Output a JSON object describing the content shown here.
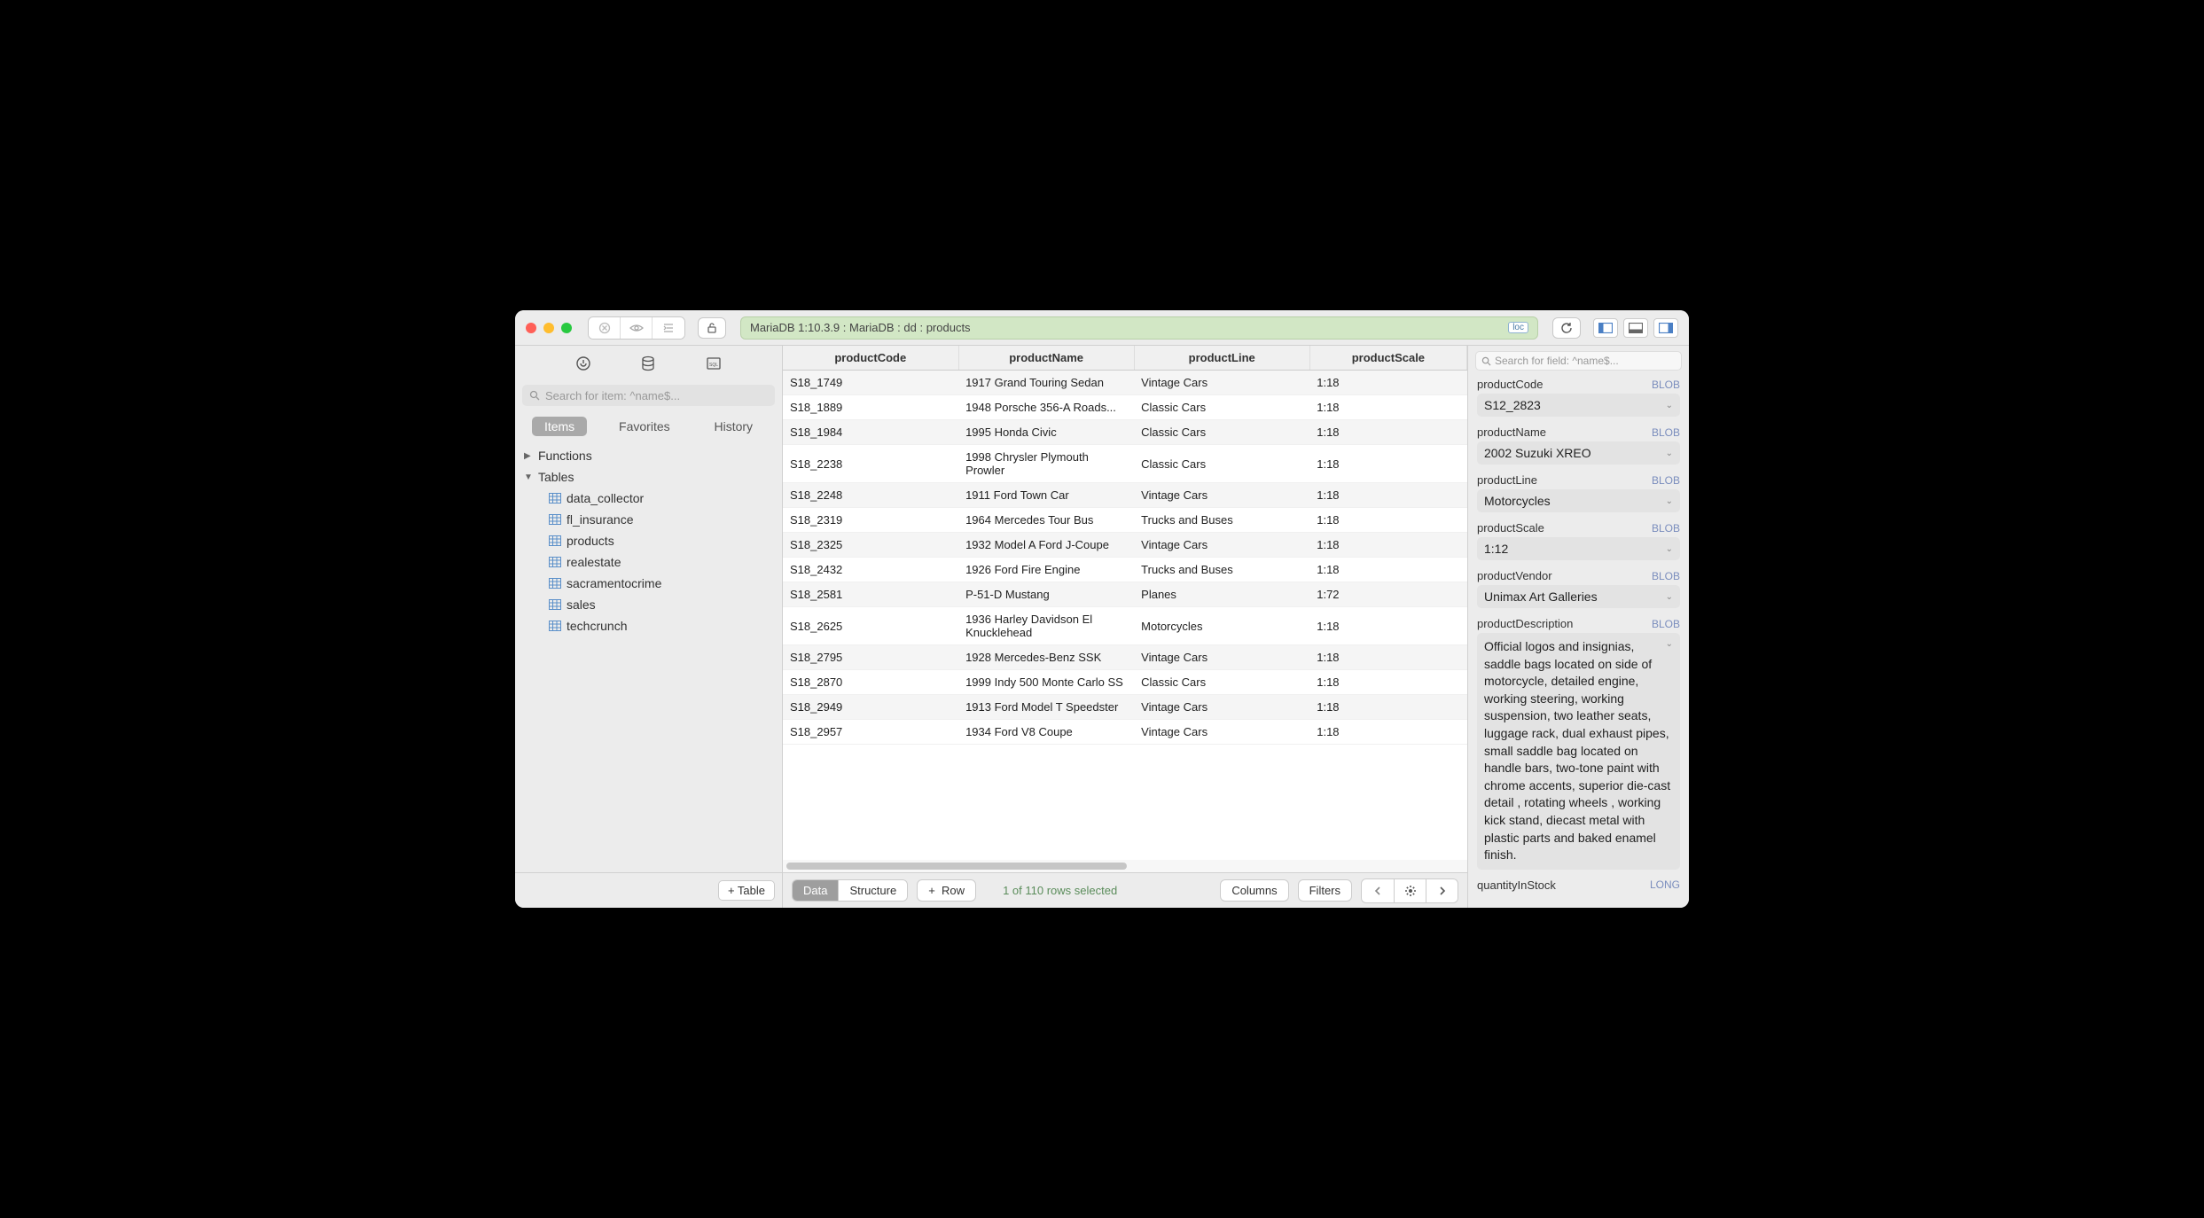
{
  "titlebar": {
    "path": "MariaDB 1:10.3.9 : MariaDB : dd : products",
    "loc_badge": "loc"
  },
  "sidebar": {
    "search_placeholder": "Search for item: ^name$...",
    "tabs": {
      "items": "Items",
      "favorites": "Favorites",
      "history": "History"
    },
    "tree": {
      "functions": "Functions",
      "tables": "Tables",
      "table_items": [
        "data_collector",
        "fl_insurance",
        "products",
        "realestate",
        "sacramentocrime",
        "sales",
        "techcrunch"
      ]
    },
    "add_table": "Table"
  },
  "table": {
    "headers": [
      "productCode",
      "productName",
      "productLine",
      "productScale"
    ],
    "rows": [
      {
        "code": "S18_1749",
        "name": "1917 Grand Touring Sedan",
        "line": "Vintage Cars",
        "scale": "1:18"
      },
      {
        "code": "S18_1889",
        "name": "1948 Porsche 356-A Roads...",
        "line": "Classic Cars",
        "scale": "1:18"
      },
      {
        "code": "S18_1984",
        "name": "1995 Honda Civic",
        "line": "Classic Cars",
        "scale": "1:18"
      },
      {
        "code": "S18_2238",
        "name": "1998 Chrysler Plymouth Prowler",
        "line": "Classic Cars",
        "scale": "1:18"
      },
      {
        "code": "S18_2248",
        "name": "1911 Ford Town Car",
        "line": "Vintage Cars",
        "scale": "1:18"
      },
      {
        "code": "S18_2319",
        "name": "1964 Mercedes Tour Bus",
        "line": "Trucks and Buses",
        "scale": "1:18"
      },
      {
        "code": "S18_2325",
        "name": "1932 Model A Ford J-Coupe",
        "line": "Vintage Cars",
        "scale": "1:18"
      },
      {
        "code": "S18_2432",
        "name": "1926 Ford Fire Engine",
        "line": "Trucks and Buses",
        "scale": "1:18"
      },
      {
        "code": "S18_2581",
        "name": "P-51-D Mustang",
        "line": "Planes",
        "scale": "1:72"
      },
      {
        "code": "S18_2625",
        "name": "1936 Harley Davidson El Knucklehead",
        "line": "Motorcycles",
        "scale": "1:18"
      },
      {
        "code": "S18_2795",
        "name": "1928 Mercedes-Benz SSK",
        "line": "Vintage Cars",
        "scale": "1:18"
      },
      {
        "code": "S18_2870",
        "name": "1999 Indy 500 Monte Carlo SS",
        "line": "Classic Cars",
        "scale": "1:18"
      },
      {
        "code": "S18_2949",
        "name": "1913 Ford Model T Speedster",
        "line": "Vintage Cars",
        "scale": "1:18"
      },
      {
        "code": "S18_2957",
        "name": "1934 Ford V8 Coupe",
        "line": "Vintage Cars",
        "scale": "1:18"
      }
    ]
  },
  "footer": {
    "data": "Data",
    "structure": "Structure",
    "row": "Row",
    "status": "1 of 110 rows selected",
    "columns": "Columns",
    "filters": "Filters"
  },
  "inspector": {
    "search_placeholder": "Search for field: ^name$...",
    "fields": [
      {
        "label": "productCode",
        "type": "BLOB",
        "value": "S12_2823"
      },
      {
        "label": "productName",
        "type": "BLOB",
        "value": "2002 Suzuki XREO"
      },
      {
        "label": "productLine",
        "type": "BLOB",
        "value": "Motorcycles"
      },
      {
        "label": "productScale",
        "type": "BLOB",
        "value": "1:12"
      },
      {
        "label": "productVendor",
        "type": "BLOB",
        "value": "Unimax Art Galleries"
      }
    ],
    "description": {
      "label": "productDescription",
      "type": "BLOB",
      "value": "Official logos and insignias, saddle bags located on side of motorcycle, detailed engine, working steering, working suspension, two leather seats, luggage rack, dual exhaust pipes, small saddle bag located on handle bars, two-tone paint with chrome accents, superior die-cast detail , rotating wheels , working kick stand, diecast metal with plastic parts and baked enamel finish."
    },
    "quantity": {
      "label": "quantityInStock",
      "type": "LONG"
    }
  }
}
